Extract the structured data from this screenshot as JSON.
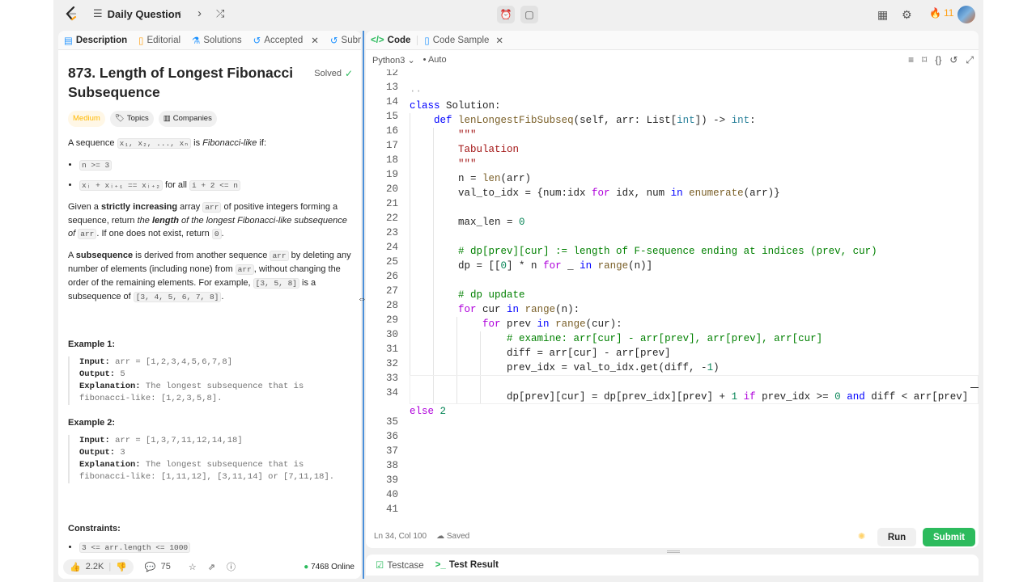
{
  "topbar": {
    "title": "Daily Question",
    "streak": "11"
  },
  "left": {
    "tabs": [
      "Description",
      "Editorial",
      "Solutions",
      "Accepted",
      "Subm"
    ],
    "problem_title": "873. Length of Longest Fibonacci Subsequence",
    "solved": "Solved",
    "tags": [
      "Medium",
      "Topics",
      "Companies"
    ],
    "p1_a": "A sequence ",
    "p1_code": "x₁, x₂, ..., xₙ",
    "p1_b": " is ",
    "p1_em": "Fibonacci-like",
    "p1_c": " if:",
    "bullet1": "n >= 3",
    "bullet2_code": "xᵢ + xᵢ₊₁ == xᵢ₊₂",
    "bullet2_text": " for all ",
    "bullet2_code2": "i + 2 <= n",
    "p2_a": "Given a ",
    "p2_b": "strictly increasing",
    "p2_c": " array ",
    "p2_code": "arr",
    "p2_d": " of positive integers forming a sequence, return ",
    "p2_e": "the ",
    "p2_f": "length",
    "p2_g": " of the longest Fibonacci-like subsequence of",
    "p2_code2": "arr",
    "p2_h": ". If one does not exist, return ",
    "p2_code3": "0",
    "p2_i": ".",
    "p3_a": "A ",
    "p3_b": "subsequence",
    "p3_c": " is derived from another sequence ",
    "p3_code": "arr",
    "p3_d": " by deleting any number of elements (including none) from ",
    "p3_code2": "arr",
    "p3_e": ", without changing the order of the remaining elements. For example, ",
    "p3_code3": "[3, 5, 8]",
    "p3_f": " is a subsequence of ",
    "p3_code4": "[3, 4, 5, 6, 7, 8]",
    "p3_g": ".",
    "ex1_title": "Example 1:",
    "ex1_input_label": "Input:",
    "ex1_input": " arr = [1,2,3,4,5,6,7,8]",
    "ex1_output_label": "Output:",
    "ex1_output": " 5",
    "ex1_expl_label": "Explanation:",
    "ex1_expl_1": " The longest subsequence that is",
    "ex1_expl_2": "fibonacci-like: [1,2,3,5,8].",
    "ex2_title": "Example 2:",
    "ex2_input_label": "Input:",
    "ex2_input": " arr = [1,3,7,11,12,14,18]",
    "ex2_output_label": "Output:",
    "ex2_output": " 3",
    "ex2_expl_label": "Explanation:",
    "ex2_expl_1": " The longest subsequence that is",
    "ex2_expl_2": "fibonacci-like: [1,11,12], [3,11,14] or [7,11,18].",
    "constraints_title": "Constraints:",
    "constraint1": "3 <= arr.length <= 1000",
    "likes": "2.2K",
    "comments": "75",
    "online": "7468 Online"
  },
  "right": {
    "tabs": [
      "Code",
      "Code Sample"
    ],
    "language": "Python3",
    "auto": "Auto",
    "status_pos": "Ln 34, Col 100",
    "status_saved": "Saved",
    "run": "Run",
    "submit": "Submit",
    "bottom_tabs": [
      "Testcase",
      "Test Result"
    ],
    "line_numbers": [
      "12",
      "13",
      "14",
      "15",
      "16",
      "17",
      "18",
      "19",
      "20",
      "21",
      "22",
      "23",
      "24",
      "25",
      "26",
      "27",
      "28",
      "29",
      "30",
      "31",
      "32",
      "33",
      "34",
      "",
      "35",
      "36",
      "37",
      "38",
      "39",
      "40",
      "41"
    ]
  }
}
